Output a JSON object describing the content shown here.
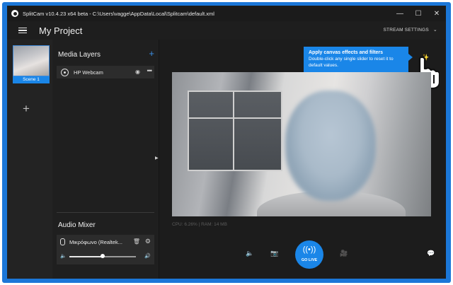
{
  "window": {
    "title": "SplitCam v10.4.23 x64 beta - C:\\Users\\vagge\\AppData\\Local\\Splitcam\\default.xml",
    "controls": {
      "minimize": "—",
      "maximize": "☐",
      "close": "✕"
    }
  },
  "header": {
    "project_title": "My Project",
    "stream_settings": "STREAM SETTINGS",
    "chevron": "⌄"
  },
  "scenes": {
    "items": [
      {
        "label": "Scene 1"
      }
    ],
    "add_label": "+"
  },
  "media_layers": {
    "title": "Media Layers",
    "add_label": "+",
    "items": [
      {
        "name": "HP Webcam",
        "visible_icon": "eye-icon",
        "more_icon": "more-icon"
      }
    ]
  },
  "audio_mixer": {
    "title": "Audio Mixer",
    "items": [
      {
        "name": "Μικρόφωνο (Realtek...",
        "volume": 0.5
      }
    ]
  },
  "tooltip": {
    "title": "Apply canvas effects and filters",
    "text": "Double-click any single slider to reset it to default values."
  },
  "stats": {
    "text": "CPU: 6.26% | RAM: 14 MB"
  },
  "controls": {
    "go_live": "GO LIVE"
  },
  "colors": {
    "accent": "#1a86e8",
    "background": "#1e1e1e",
    "frame": "#1b77d8"
  }
}
